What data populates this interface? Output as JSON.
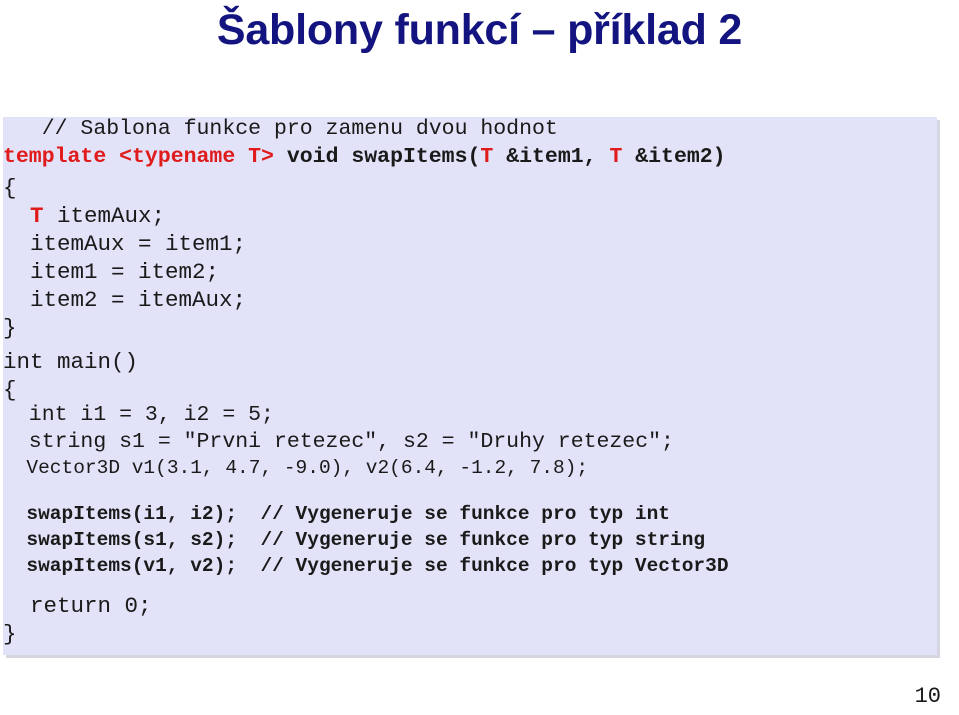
{
  "slide": {
    "title": "Šablony funkcí – příklad 2",
    "title_color": "#141480",
    "page_number": "10",
    "background_color": "#ffffff"
  },
  "code_panel": {
    "background_color": "#e2e2f8",
    "comment_color": "#1a1a1a",
    "keyword_color": "#e01b1b",
    "text_color": "#1a1a1a",
    "lines": {
      "l01_comment": "   // Sablona funkce pro zamenu dvou hodnot",
      "l02_template_kw": "template <typename T>",
      "l02_space": " ",
      "l02_signature_a": "void swapItems(",
      "l02_t1": "T",
      "l02_mid": " &item1, ",
      "l02_t2": "T",
      "l02_sig_end": " &item2)",
      "l03_brace_open": "{",
      "l04_indent": "  ",
      "l04_t": "T",
      "l04_rest": " itemAux;",
      "l05": "  itemAux = item1;",
      "l06": "  item1 = item2;",
      "l07": "  item2 = itemAux;",
      "l08_brace_close": "}",
      "l09_blank": " ",
      "l10_main": "int main()",
      "l11_brace_open": "{",
      "l12": "  int i1 = 3, i2 = 5;",
      "l13": "  string s1 = \"Prvni retezec\", s2 = \"Druhy retezec\";",
      "l14": "  Vector3D v1(3.1, 4.7, -9.0), v2(6.4, -1.2, 7.8);",
      "l15_blank": " ",
      "l16": "  swapItems(i1, i2);  // Vygeneruje se funkce pro typ int",
      "l17": "  swapItems(s1, s2);  // Vygeneruje se funkce pro typ string",
      "l18": "  swapItems(v1, v2);  // Vygeneruje se funkce pro typ Vector3D",
      "l19_blank": " ",
      "l20_return": "  return 0;",
      "l21_brace_close": "}"
    }
  }
}
